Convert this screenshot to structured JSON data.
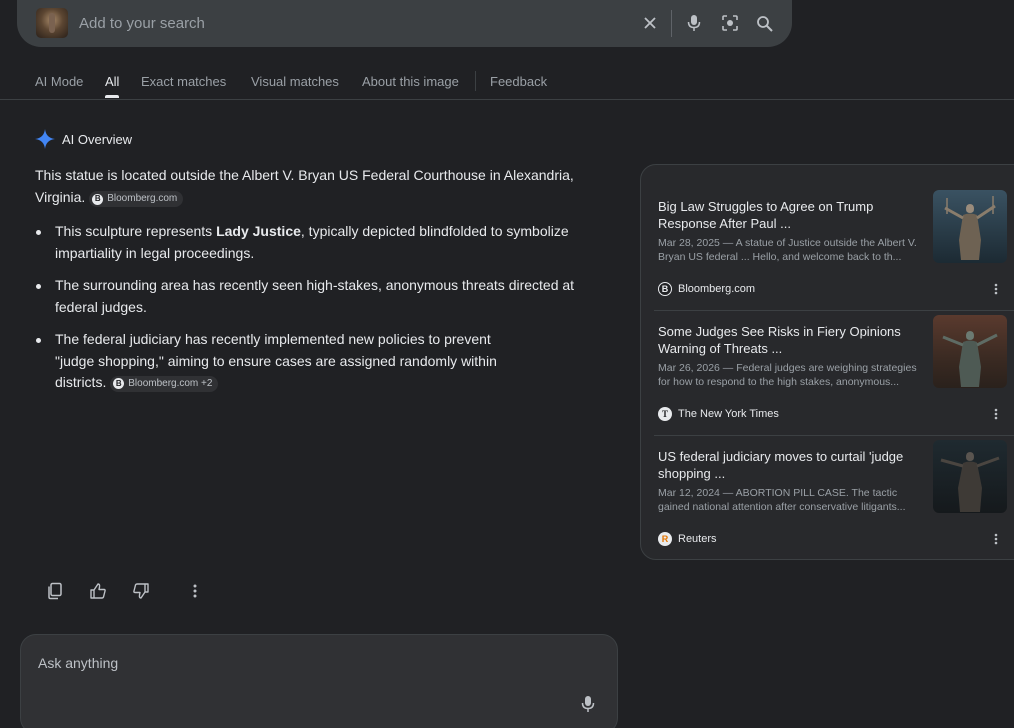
{
  "search": {
    "placeholder": "Add to your search"
  },
  "tabs": [
    {
      "label": "AI Mode"
    },
    {
      "label": "All"
    },
    {
      "label": "Exact matches"
    },
    {
      "label": "Visual matches"
    },
    {
      "label": "About this image"
    },
    {
      "label": "Feedback"
    }
  ],
  "active_tab": "All",
  "overview": {
    "heading": "AI Overview",
    "intro": "This statue is located outside the Albert V. Bryan US Federal Courthouse in Alexandria, Virginia.",
    "intro_chip": "Bloomberg.com",
    "bullets": [
      {
        "before": "This sculpture represents ",
        "bold": "Lady Justice",
        "after": ", typically depicted blindfolded to symbolize impartiality in legal proceedings."
      },
      {
        "text": "The surrounding area has recently seen high-stakes, anonymous threats directed at federal judges."
      },
      {
        "text": "The federal judiciary has recently implemented new policies to prevent \"judge shopping,\" aiming to ensure cases are assigned randomly within districts.",
        "chip": "Bloomberg.com +2"
      }
    ]
  },
  "ask": {
    "placeholder": "Ask anything"
  },
  "sources": [
    {
      "title": "Big Law Struggles to Agree on Trump Response After Paul ...",
      "snippet": "Mar 28, 2025 — A statue of Justice outside the Albert V. Bryan US federal ... Hello, and welcome back to th...",
      "site": "Bloomberg.com",
      "favicon": "B"
    },
    {
      "title": "Some Judges See Risks in Fiery Opinions Warning of Threats ...",
      "snippet": "Mar 26, 2026 — Federal judges are weighing strategies for how to respond to the high stakes, anonymous...",
      "site": "The New York Times",
      "favicon": "T"
    },
    {
      "title": "US federal judiciary moves to curtail 'judge shopping ...",
      "snippet": "Mar 12, 2024 — ABORTION PILL CASE. The tactic gained national attention after conservative litigants...",
      "site": "Reuters",
      "favicon": "R"
    }
  ],
  "colors": {
    "background": "#202124",
    "surface": "#303134",
    "text": "#e8eaed",
    "muted": "#9aa0a6",
    "sparkle": "#4285f4"
  }
}
